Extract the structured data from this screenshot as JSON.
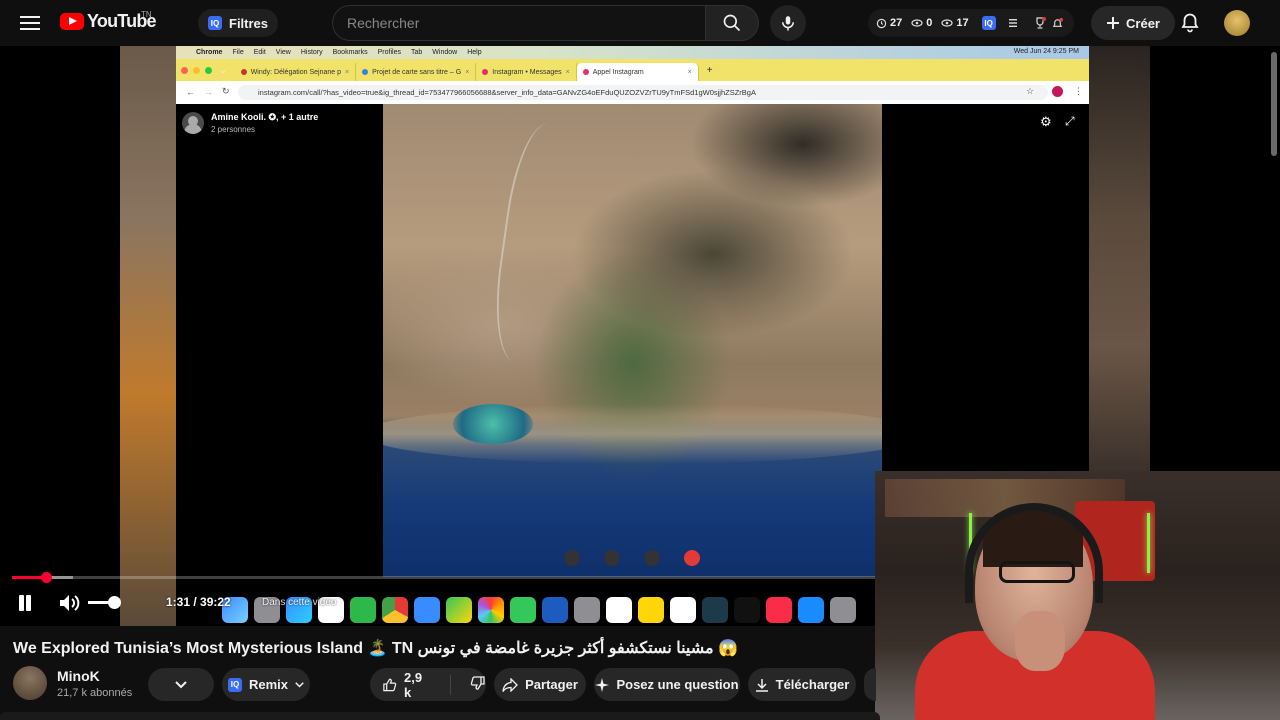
{
  "header": {
    "logo_text": "YouTube",
    "country": "TN",
    "filters_label": "Filtres",
    "iq_label": "IQ",
    "search_placeholder": "Rechercher",
    "stats": {
      "likes": "27",
      "views_a": "0",
      "views_b": "17"
    },
    "create_label": "Créer"
  },
  "embedded": {
    "mac_menu": [
      "Chrome",
      "File",
      "Edit",
      "View",
      "History",
      "Bookmarks",
      "Profiles",
      "Tab",
      "Window",
      "Help"
    ],
    "mac_clock": "Wed Jun 24  9:25 PM",
    "tabs": [
      {
        "label": "Windy: Délégation Sejnane p",
        "color": "#c0392b"
      },
      {
        "label": "Projet de carte sans titre – G",
        "color": "#2e86de"
      },
      {
        "label": "Instagram • Messages",
        "color": "#e1306c"
      },
      {
        "label": "Appel Instagram",
        "color": "#e1306c"
      }
    ],
    "url": "instagram.com/call/?has_video=true&ig_thread_id=753477966056688&server_info_data=GANvZG4oEFduQUZOZVZrTU9yTmFSd1gW0sjjhZSZrBgA",
    "caller_name": "Amine Kooli. ✪, + 1 autre",
    "caller_sub": "2 personnes"
  },
  "player": {
    "time": "1:31 / 39:22",
    "chapter": "Dans cette vidéo",
    "progress": 0.039,
    "buffered": 0.071
  },
  "video_info": {
    "title": "We Explored Tunisia’s Most Mysterious Island 🏝️ TN مشينا نستكشفو أكثر جزيرة غامضة في تونس 😱",
    "channel_name": "MinoK",
    "channel_subs": "21,7 k abonnés",
    "remix_label": "Remix",
    "like_count": "2,9 k",
    "share_label": "Partager",
    "ask_label": "Posez une question",
    "download_label": "Télécharger"
  }
}
